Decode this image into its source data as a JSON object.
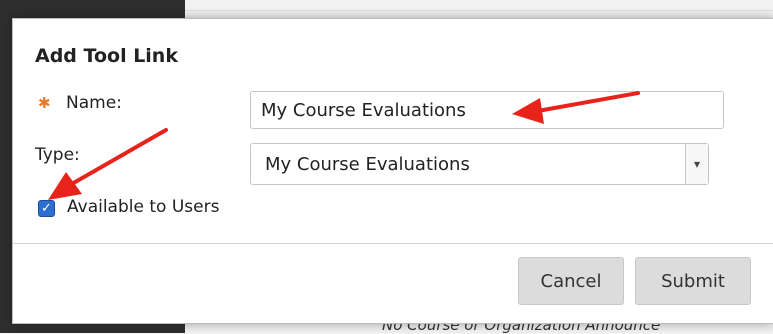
{
  "dialog": {
    "title": "Add Tool Link",
    "name_label": "Name:",
    "name_value": "My Course Evaluations",
    "type_label": "Type:",
    "type_selected": "My Course Evaluations",
    "available_label": "Available to Users",
    "available_checked": true,
    "cancel_label": "Cancel",
    "submit_label": "Submit"
  },
  "background": {
    "footer_text": "No Course or Organization Announce"
  },
  "annotations": {
    "arrow_color": "#e8231a"
  },
  "colors": {
    "required_star": "#e8792a",
    "checkbox": "#2d6fd1"
  },
  "icons": [
    "required-star-icon",
    "select-arrow-icon",
    "checkmark-icon",
    "annotation-arrow"
  ]
}
